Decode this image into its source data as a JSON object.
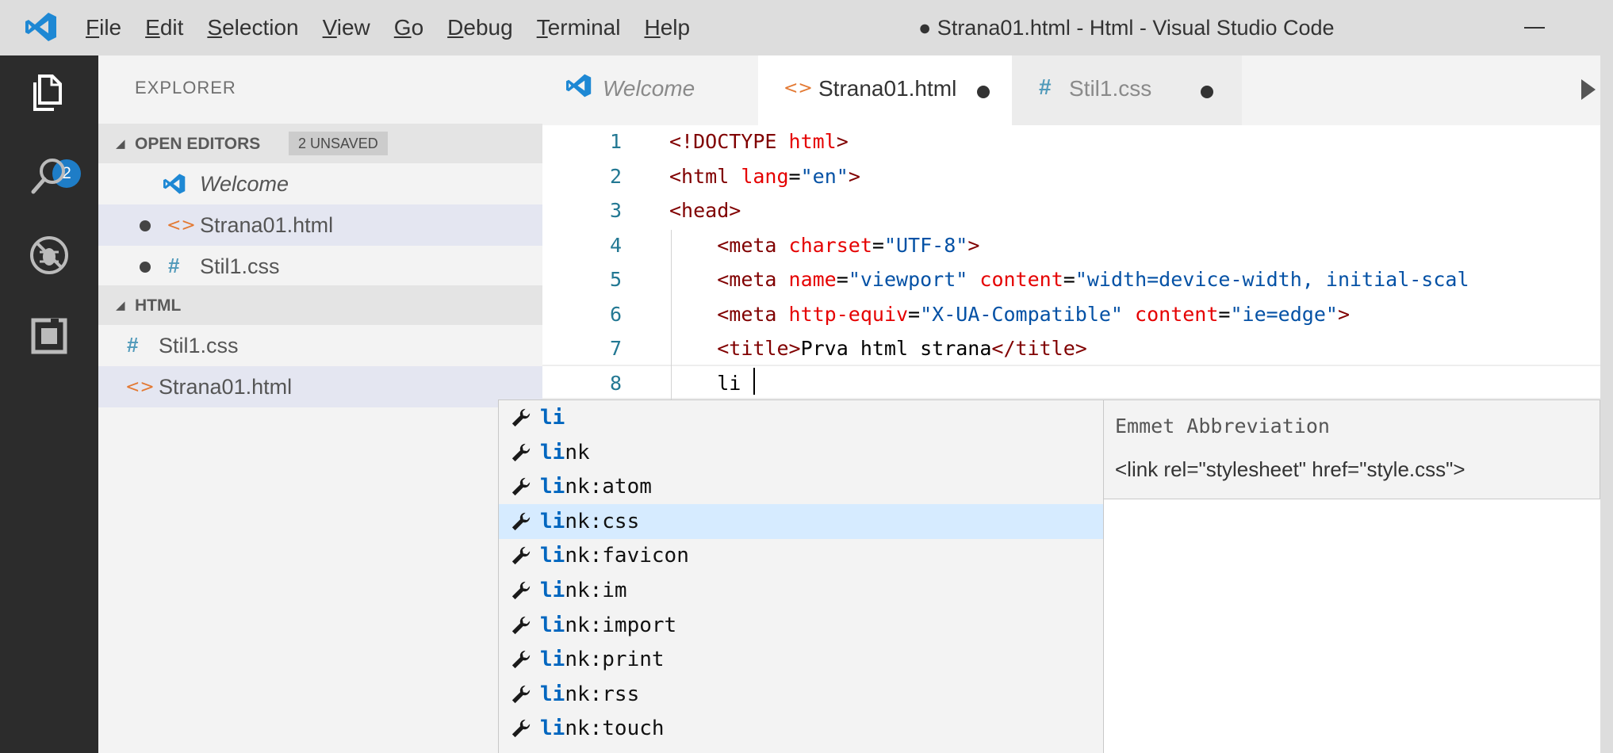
{
  "window": {
    "title": "● Strana01.html - Html - Visual Studio Code",
    "menu": [
      {
        "acc": "F",
        "rest": "ile"
      },
      {
        "acc": "E",
        "rest": "dit"
      },
      {
        "acc": "S",
        "rest": "election"
      },
      {
        "acc": "V",
        "rest": "iew"
      },
      {
        "acc": "G",
        "rest": "o"
      },
      {
        "acc": "D",
        "rest": "ebug"
      },
      {
        "acc": "T",
        "rest": "erminal"
      },
      {
        "acc": "H",
        "rest": "elp"
      }
    ]
  },
  "activity_bar": {
    "items": [
      "explorer-icon",
      "search-icon",
      "debug-icon",
      "extensions-icon"
    ],
    "explorer_badge": "2"
  },
  "sidebar": {
    "title": "EXPLORER",
    "open_editors": {
      "header": "OPEN EDITORS",
      "badge": "2 UNSAVED",
      "items": [
        "Welcome",
        "Strana01.html",
        "Stil1.css"
      ]
    },
    "folder": {
      "header": "HTML",
      "items": [
        "Stil1.css",
        "Strana01.html"
      ]
    }
  },
  "tabs": [
    {
      "label": "Welcome",
      "italic": true,
      "icon": "vscode-icon"
    },
    {
      "label": "Strana01.html",
      "active": true,
      "dirty": true,
      "icon": "html-icon",
      "icon_text": "<>"
    },
    {
      "label": "Stil1.css",
      "dirty": true,
      "icon": "css-icon",
      "icon_text": "#"
    }
  ],
  "editor": {
    "line_numbers": [
      "1",
      "2",
      "3",
      "4",
      "5",
      "6",
      "7",
      "8"
    ],
    "lines": [
      [
        [
          "tg",
          "<!DOCTYPE "
        ],
        [
          "at",
          "html"
        ],
        [
          "tg",
          ">"
        ]
      ],
      [
        [
          "tg",
          "<html "
        ],
        [
          "at",
          "lang"
        ],
        [
          "tx",
          "="
        ],
        [
          "vl",
          "\"en\""
        ],
        [
          "tg",
          ">"
        ]
      ],
      [
        [
          "tg",
          "<head>"
        ]
      ],
      [
        [
          "tx",
          "    "
        ],
        [
          "tg",
          "<meta "
        ],
        [
          "at",
          "charset"
        ],
        [
          "tx",
          "="
        ],
        [
          "vl",
          "\"UTF-8\""
        ],
        [
          "tg",
          ">"
        ]
      ],
      [
        [
          "tx",
          "    "
        ],
        [
          "tg",
          "<meta "
        ],
        [
          "at",
          "name"
        ],
        [
          "tx",
          "="
        ],
        [
          "vl",
          "\"viewport\" "
        ],
        [
          "at",
          "content"
        ],
        [
          "tx",
          "="
        ],
        [
          "vl",
          "\"width=device-width, initial-scal"
        ]
      ],
      [
        [
          "tx",
          "    "
        ],
        [
          "tg",
          "<meta "
        ],
        [
          "at",
          "http-equiv"
        ],
        [
          "tx",
          "="
        ],
        [
          "vl",
          "\"X-UA-Compatible\" "
        ],
        [
          "at",
          "content"
        ],
        [
          "tx",
          "="
        ],
        [
          "vl",
          "\"ie=edge\""
        ],
        [
          "tg",
          ">"
        ]
      ],
      [
        [
          "tx",
          "    "
        ],
        [
          "tg",
          "<title>"
        ],
        [
          "tx",
          "Prva html strana"
        ],
        [
          "tg",
          "</title>"
        ]
      ],
      [
        [
          "tx",
          "    li"
        ]
      ]
    ]
  },
  "suggest": {
    "typed": "li",
    "items": [
      {
        "match": "li",
        "rest": ""
      },
      {
        "match": "li",
        "rest": "nk"
      },
      {
        "match": "li",
        "rest": "nk:atom"
      },
      {
        "match": "li",
        "rest": "nk:css",
        "selected": true
      },
      {
        "match": "li",
        "rest": "nk:favicon"
      },
      {
        "match": "li",
        "rest": "nk:im"
      },
      {
        "match": "li",
        "rest": "nk:import"
      },
      {
        "match": "li",
        "rest": "nk:print"
      },
      {
        "match": "li",
        "rest": "nk:rss"
      },
      {
        "match": "li",
        "rest": "nk:touch"
      }
    ],
    "detail_title": "Emmet Abbreviation",
    "detail_doc": "<link rel=\"stylesheet\" href=\"style.css\">"
  },
  "colors": {
    "activity_bar": "#2c2c2c",
    "sidebar": "#f3f3f3",
    "badge": "#1e7dc7",
    "html_icon": "#e37933",
    "css_icon": "#519aba",
    "vscode_blue": "#1e88d4",
    "match_highlight": "#0066bf",
    "selected_suggestion": "#d6ebff"
  }
}
